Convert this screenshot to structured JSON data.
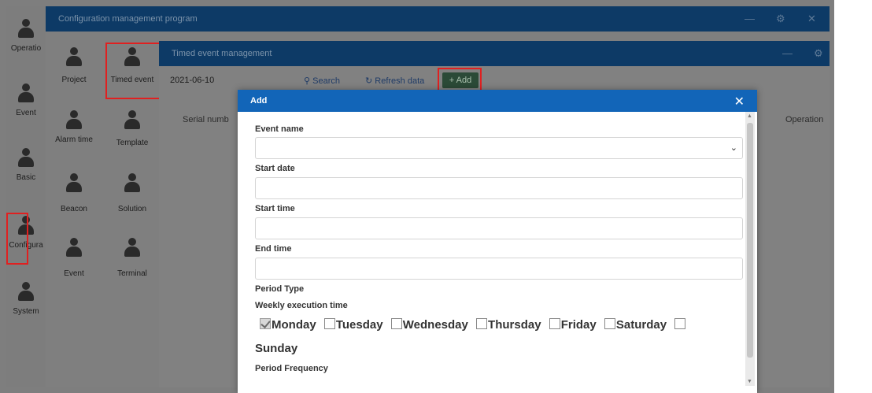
{
  "left_rail": {
    "items": [
      {
        "label": "Operatio"
      },
      {
        "label": "Event"
      },
      {
        "label": "Basic"
      },
      {
        "label": "Configura"
      },
      {
        "label": "System"
      }
    ]
  },
  "app_window": {
    "title": "Configuration management program",
    "minimize": "—",
    "settings": "⚙",
    "close": "✕",
    "modules": [
      {
        "label": "Project"
      },
      {
        "label": "Timed event"
      },
      {
        "label": "Alarm time"
      },
      {
        "label": "Template"
      },
      {
        "label": "Beacon"
      },
      {
        "label": "Solution"
      },
      {
        "label": "Event"
      },
      {
        "label": "Terminal"
      }
    ]
  },
  "timed_window": {
    "title": "Timed event management",
    "minimize": "—",
    "settings": "⚙",
    "date_value": "2021-06-10",
    "search_label": "Search",
    "refresh_label": "Refresh data",
    "add_label": "Add",
    "table_headers": {
      "serial": "Serial numb",
      "operation": "Operation"
    }
  },
  "add_modal": {
    "title": "Add",
    "close": "✕",
    "event_name_label": "Event name",
    "event_name_value": "",
    "start_date_label": "Start date",
    "start_time_label": "Start time",
    "end_time_label": "End time",
    "period_type_label": "Period Type",
    "weekly_label": "Weekly execution time",
    "days": [
      {
        "label": "Monday",
        "checked": true
      },
      {
        "label": "Tuesday",
        "checked": false
      },
      {
        "label": "Wednesday",
        "checked": false
      },
      {
        "label": "Thursday",
        "checked": false
      },
      {
        "label": "Friday",
        "checked": false
      },
      {
        "label": "Saturday",
        "checked": false
      },
      {
        "label": "Sunday",
        "checked": false
      }
    ],
    "period_frequency_label": "Period Frequency"
  },
  "colors": {
    "title_bar": "#0d3a66",
    "modal_header": "#1265b8",
    "highlight": "#e02020"
  }
}
